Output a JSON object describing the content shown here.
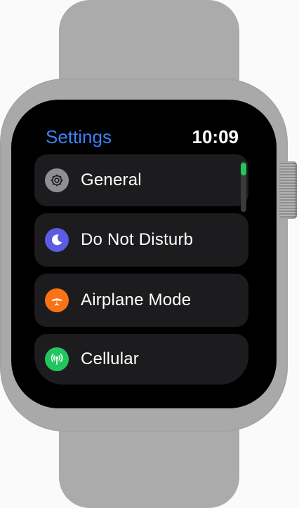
{
  "header": {
    "title": "Settings",
    "time": "10:09"
  },
  "settings": {
    "items": [
      {
        "label": "General",
        "icon": "gear-icon",
        "icon_color": "#8e8e93"
      },
      {
        "label": "Do Not Disturb",
        "icon": "moon-icon",
        "icon_color": "#5b5ce2"
      },
      {
        "label": "Airplane Mode",
        "icon": "airplane-icon",
        "icon_color": "#f97316"
      },
      {
        "label": "Cellular",
        "icon": "antenna-icon",
        "icon_color": "#22c55e"
      }
    ]
  },
  "colors": {
    "accent": "#3b82f6",
    "screen_background": "#000000",
    "cell_background": "#1c1c1e",
    "scroll_thumb": "#22c55e"
  },
  "scroll": {
    "position": 0
  }
}
